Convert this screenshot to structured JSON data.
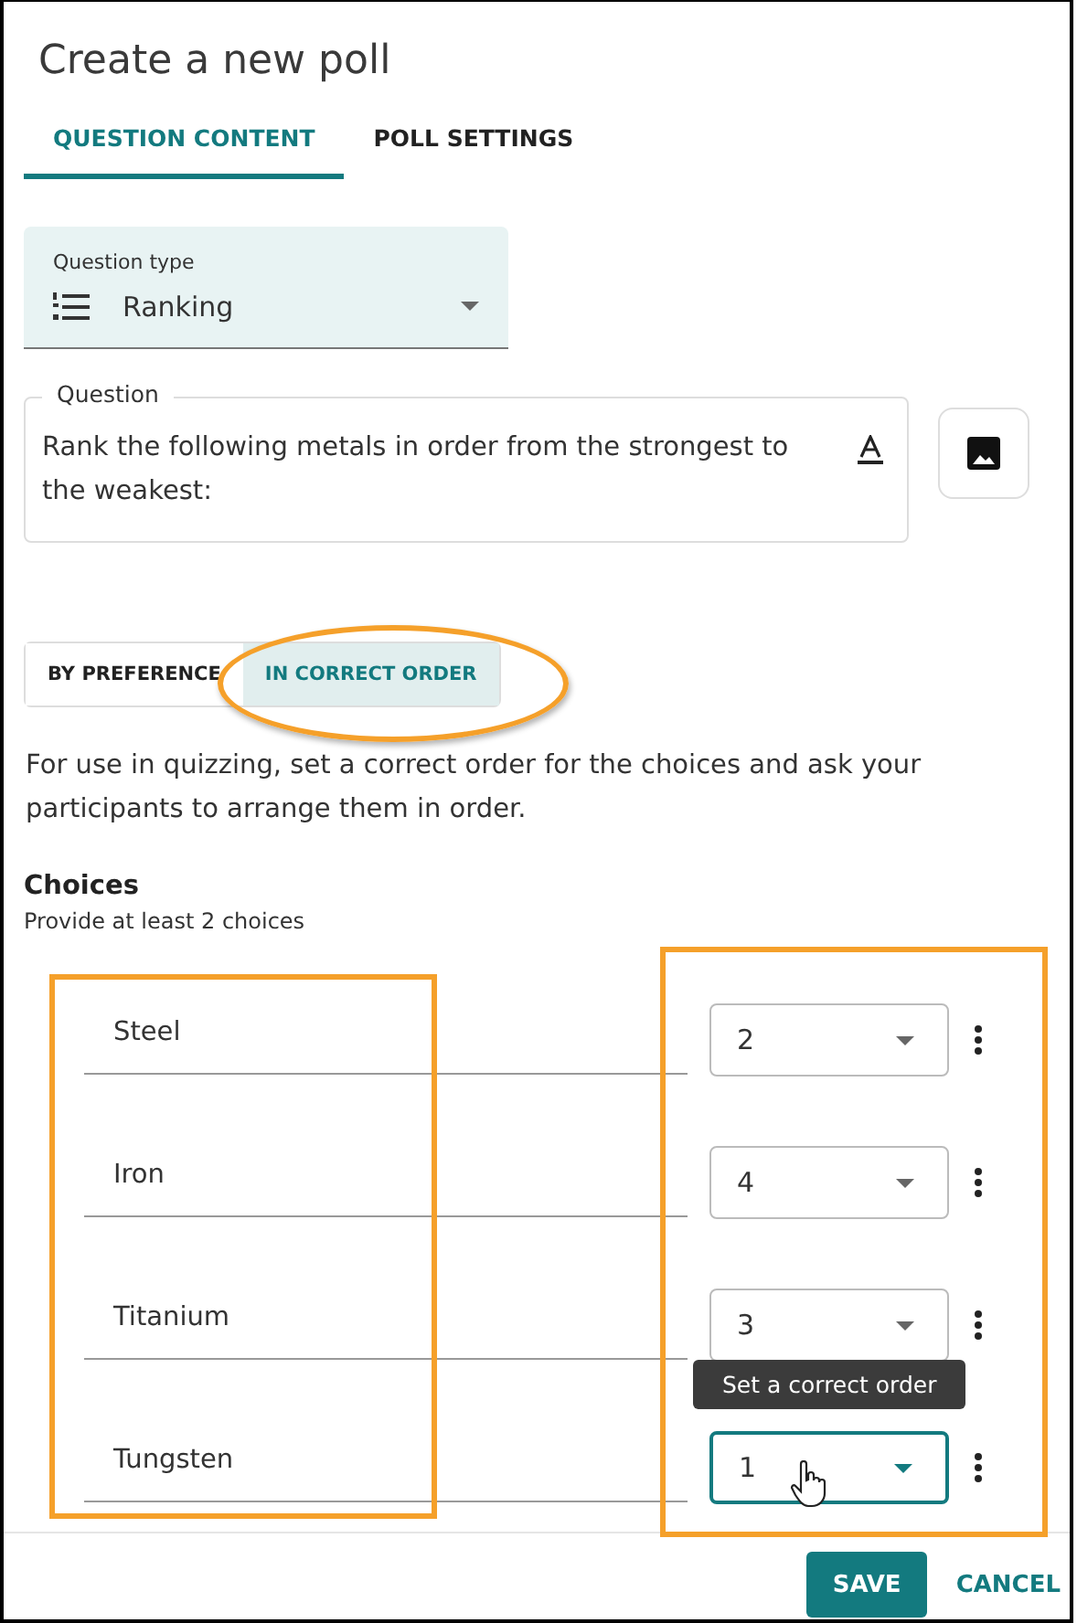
{
  "dialog": {
    "title": "Create a new poll"
  },
  "tabs": [
    {
      "label": "QUESTION CONTENT",
      "selected": true
    },
    {
      "label": "POLL SETTINGS",
      "selected": false
    }
  ],
  "question_type": {
    "label": "Question type",
    "value": "Ranking"
  },
  "question": {
    "label": "Question",
    "value": "Rank the following metals in order from the strongest to the weakest:"
  },
  "ranking_mode": [
    {
      "label": "BY PREFERENCE",
      "selected": false
    },
    {
      "label": "IN CORRECT ORDER",
      "selected": true
    }
  ],
  "description": "For use in quizzing, set a correct order for the choices and ask your participants to arrange them in order.",
  "choices_heading": "Choices",
  "choices_hint": "Provide at least 2 choices",
  "choices": [
    {
      "name": "Steel",
      "order": "2",
      "focused": false
    },
    {
      "name": "Iron",
      "order": "4",
      "focused": false
    },
    {
      "name": "Titanium",
      "order": "3",
      "focused": false
    },
    {
      "name": "Tungsten",
      "order": "1",
      "focused": true
    }
  ],
  "tooltip": "Set a correct order",
  "buttons": [
    {
      "label": "SAVE",
      "kind": "primary"
    },
    {
      "label": "CANCEL",
      "kind": "text"
    }
  ]
}
